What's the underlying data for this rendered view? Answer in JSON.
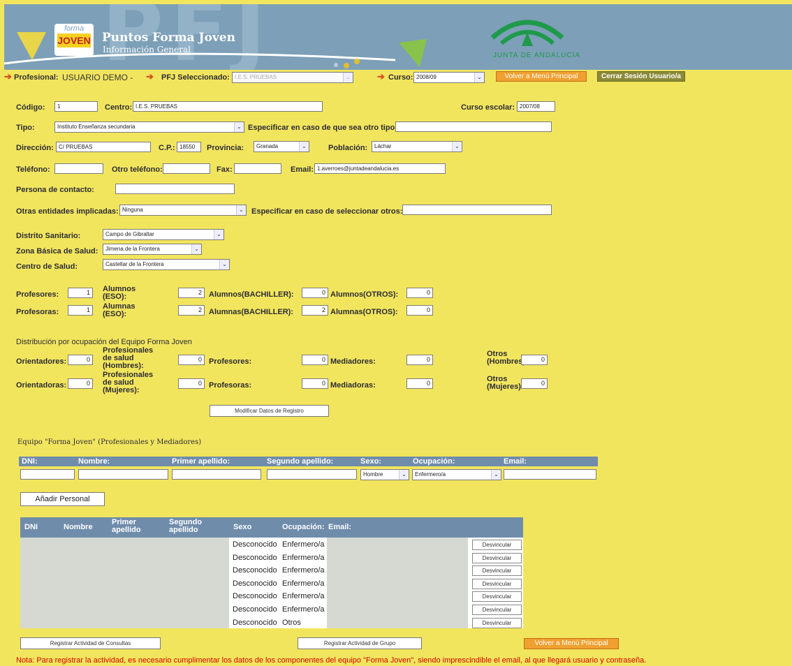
{
  "header": {
    "logo_text_top": "forma",
    "logo_text_bottom": "JOVEN",
    "app_title": "Puntos Forma Joven",
    "app_subtitle": "Información General",
    "junta_text": "JUNTA DE ANDALUCIA",
    "watermark": "PFJ"
  },
  "topnav": {
    "profesional_label": "Profesional:",
    "profesional_value": "USUARIO DEMO -",
    "pfj_label": "PFJ Seleccionado:",
    "pfj_value": "I.E.S. PRUEBAS",
    "curso_label": "Curso:",
    "curso_value": "2008/09",
    "menu_button": "Volver a Menú Principal",
    "logout_button": "Cerrar Sesión Usuario/a"
  },
  "form": {
    "codigo_label": "Código:",
    "codigo_value": "1",
    "centro_label": "Centro:",
    "centro_value": "I.E.S. PRUEBAS",
    "curso_escolar_label": "Curso escolar:",
    "curso_escolar_value": "2007/08",
    "tipo_label": "Tipo:",
    "tipo_value": "Instituto Enseñanza secundaria",
    "especificar_tipo_label": "Especificar en caso de que sea otro tipo:",
    "especificar_tipo_value": "",
    "direccion_label": "Dirección:",
    "direccion_value": "C/ PRUEBAS",
    "cp_label": "C.P.:",
    "cp_value": "18550",
    "provincia_label": "Provincia:",
    "provincia_value": "Granada",
    "poblacion_label": "Población:",
    "poblacion_value": "Láchar",
    "telefono_label": "Teléfono:",
    "otro_telefono_label": "Otro teléfono:",
    "fax_label": "Fax:",
    "email_label": "Email:",
    "email_value": "1.averroes@juntadeandalucia.es",
    "contacto_label": "Persona de contacto:",
    "otras_entidades_label": "Otras entidades implicadas:",
    "otras_entidades_value": "Ninguna",
    "especificar_otros_label": "Especificar en caso de seleccionar otros:",
    "distrito_label": "Distrito Sanitario:",
    "distrito_value": "Campo de Gibraltar",
    "zona_label": "Zona Básica de Salud:",
    "zona_value": "Jimena de la Frontera",
    "centro_salud_label": "Centro de Salud:",
    "centro_salud_value": "Castellar de la Frontera",
    "profesores_label": "Profesores:",
    "profesores_value": "1",
    "profesoras_label": "Profesoras:",
    "profesoras_value": "1",
    "alumnos_eso_label": "Alumnos (ESO):",
    "alumnos_eso_value": "2",
    "alumnas_eso_label": "Alumnas (ESO):",
    "alumnas_eso_value": "2",
    "alumnos_bach_label": "Alumnos(BACHILLER):",
    "alumnos_bach_value": "0",
    "alumnas_bach_label": "Alumnas(BACHILLER):",
    "alumnas_bach_value": "2",
    "alumnos_otros_label": "Alumnos(OTROS):",
    "alumnos_otros_value": "0",
    "alumnas_otros_label": "Alumnas(OTROS):",
    "alumnas_otros_value": "0",
    "distribucion_title": "Distribución por ocupación del Equipo Forma Joven",
    "orientadores_label": "Orientadores:",
    "orientadores_value": "0",
    "orientadoras_label": "Orientadoras:",
    "orientadoras_value": "0",
    "prof_salud_h_label": "Profesionales de salud (Hombres):",
    "prof_salud_h_value": "0",
    "prof_salud_m_label": "Profesionales de salud (Mujeres):",
    "prof_salud_m_value": "0",
    "profesores2_label": "Profesores:",
    "profesores2_value": "0",
    "profesoras2_label": "Profesoras:",
    "profesoras2_value": "0",
    "mediadores_label": "Mediadores:",
    "mediadores_value": "0",
    "mediadoras_label": "Mediadoras:",
    "mediadoras_value": "0",
    "otros_h_label": "Otros (Hombres):",
    "otros_h_value": "0",
    "otros_m_label": "Otros (Mujeres):",
    "otros_m_value": "0",
    "modificar_button": "Modificar Datos de Registro"
  },
  "equipo": {
    "title": "Equipo \"Forma Joven\" (Profesionales y Mediadores)",
    "headers": [
      "DNI:",
      "Nombre:",
      "Primer apellido:",
      "Segundo apellido:",
      "Sexo:",
      "Ocupación:",
      "Email:"
    ],
    "sexo_value": "Hombre",
    "ocupacion_value": "Enfermero/a",
    "add_button": "Añadir Personal"
  },
  "table": {
    "headers": [
      "DNI",
      "Nombre",
      "Primer apellido",
      "Segundo apellido",
      "Sexo",
      "Ocupación:",
      "Email:"
    ],
    "rows": [
      {
        "sexo": "Desconocido",
        "ocupacion": "Enfermero/a",
        "action": "Desvincular"
      },
      {
        "sexo": "Desconocido",
        "ocupacion": "Enfermero/a",
        "action": "Desvincular"
      },
      {
        "sexo": "Desconocido",
        "ocupacion": "Enfermero/a",
        "action": "Desvincular"
      },
      {
        "sexo": "Desconocido",
        "ocupacion": "Enfermero/a",
        "action": "Desvincular"
      },
      {
        "sexo": "Desconocido",
        "ocupacion": "Enfermero/a",
        "action": "Desvincular"
      },
      {
        "sexo": "Desconocido",
        "ocupacion": "Enfermero/a",
        "action": "Desvincular"
      },
      {
        "sexo": "Desconocido",
        "ocupacion": "Otros",
        "action": "Desvincular"
      }
    ]
  },
  "footer": {
    "consultas_button": "Registrar Actividad de Consultas",
    "grupo_button": "Registrar Actividad de Grupo",
    "menu_button": "Volver a Menú Principal",
    "note": "Nota: Para registrar la actividad, es necesario cumplimentar los datos de los componentes del equipo \"Forma Joven\", siendo imprescindible el email, al que llegará usuario y contraseña."
  }
}
